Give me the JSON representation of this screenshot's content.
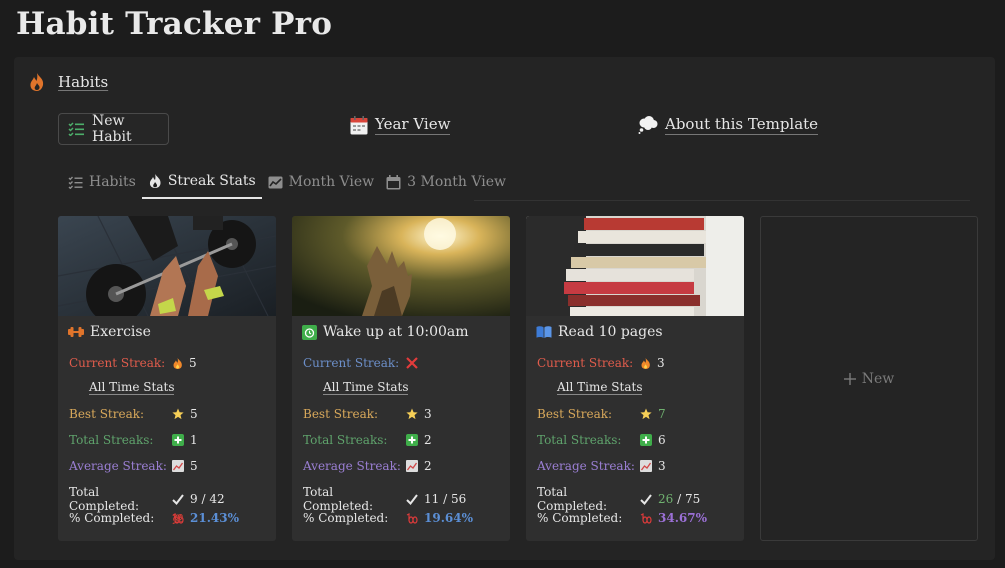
{
  "app": {
    "title": "Habit Tracker Pro"
  },
  "section": {
    "label": "Habits",
    "icon": "fire-icon"
  },
  "toolbar": {
    "new_habit": "New Habit",
    "year_view": "Year View",
    "about": "About this Template"
  },
  "tabs": [
    {
      "label": "Habits",
      "icon": "checklist-icon",
      "active": false
    },
    {
      "label": "Streak Stats",
      "icon": "flame-icon",
      "active": true
    },
    {
      "label": "Month View",
      "icon": "chart-icon",
      "active": false
    },
    {
      "label": "3 Month View",
      "icon": "calendar-icon",
      "active": false
    }
  ],
  "labels": {
    "current_streak": "Current Streak:",
    "all_time": "All Time Stats",
    "best_streak": "Best Streak:",
    "total_streaks": "Total Streaks:",
    "average_streak": "Average Streak:",
    "total_completed": "Total Completed:",
    "pct_completed": "% Completed:"
  },
  "cards": [
    {
      "title": "Exercise",
      "icon": "dumbbell-icon",
      "current_streak": "5",
      "current_streak_icon": "fire-icon",
      "best_streak": "5",
      "total_streaks": "1",
      "average_streak": "5",
      "completed": "9",
      "total": "42",
      "pct": "21.43%",
      "pct_color": "#5b8fd6"
    },
    {
      "title": "Wake up at 10:00am",
      "icon": "alarm-icon",
      "current_streak": "",
      "current_streak_icon": "cross-icon",
      "best_streak": "3",
      "total_streaks": "2",
      "average_streak": "2",
      "completed": "11",
      "total": "56",
      "pct": "19.64%",
      "pct_color": "#5b8fd6"
    },
    {
      "title": "Read 10 pages",
      "icon": "book-icon",
      "current_streak": "3",
      "current_streak_icon": "fire-icon",
      "best_streak": "7",
      "total_streaks": "6",
      "average_streak": "3",
      "completed": "26",
      "total": "75",
      "pct": "34.67%",
      "pct_color": "#9b70d6"
    }
  ],
  "new_card": {
    "label": "New"
  },
  "colors": {
    "background": "#1c1c1c",
    "panel": "#242424",
    "card": "#2f2f2f",
    "current_streak": "#e05c4c",
    "current_streak_alt": "#6c8fc9",
    "best_streak": "#d9a95b",
    "total_streaks": "#5fa36c",
    "average_streak": "#9b7fd4"
  }
}
